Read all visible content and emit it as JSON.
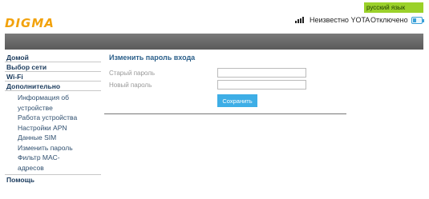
{
  "header": {
    "language": "русский язык",
    "logo": "DIGMA",
    "operator": "Неизвестно YOTA",
    "connection_status": "Отключено"
  },
  "sidebar": {
    "main_items": [
      "Домой",
      "Выбор сети",
      "Wi-Fi",
      "Дополнительно"
    ],
    "sub_items": [
      "Информация об",
      "устройстве",
      "Работа устройства",
      "Настройки APN",
      "Данные SIM",
      "Изменить пароль",
      "Фильтр MAC-",
      "адресов"
    ],
    "help": "Помощь"
  },
  "main": {
    "title": "Изменить пароль входа",
    "old_password_label": "Старый пароль",
    "new_password_label": "Новый пароль",
    "old_password_value": "",
    "new_password_value": "",
    "save_label": "Сохранить"
  },
  "colors": {
    "accent": "#3eaee6",
    "language_badge": "#9bd12a",
    "logo": "#f2a20c",
    "banner": "#6a6a6a"
  }
}
